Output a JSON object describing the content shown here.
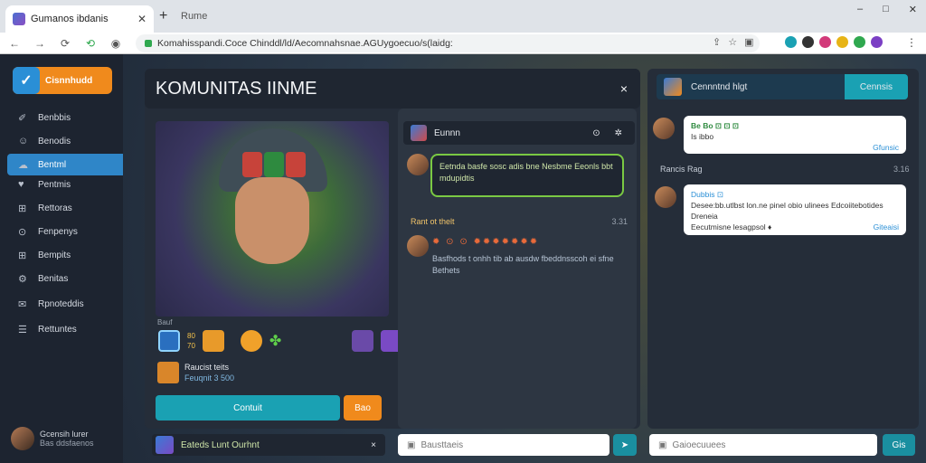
{
  "browser": {
    "tab_title": "Gumanos ibdanis",
    "tab2": "Rume",
    "url": "Komahisspandi.Coce Chinddl/ld/Aecomnahsnae.AGUygoecuo/s(laidg:"
  },
  "sidebar": {
    "logo": "Cisnnhudd",
    "items": [
      {
        "icon": "✐",
        "label": "Benbbis"
      },
      {
        "icon": "☺",
        "label": "Benodis"
      },
      {
        "icon": "☁",
        "label": "Bentml"
      },
      {
        "icon": "♥",
        "label": "Pentmis"
      },
      {
        "icon": "⊞",
        "label": "Rettoras"
      },
      {
        "icon": "⊙",
        "label": "Fenpenys"
      },
      {
        "icon": "⊞",
        "label": "Bempits"
      },
      {
        "icon": "⚙",
        "label": "Benitas"
      },
      {
        "icon": "✉",
        "label": "Rpnoteddis"
      },
      {
        "icon": "☰",
        "label": "Rettuntes"
      }
    ],
    "user_name": "Gcensih lurer",
    "user_sub": "Bas ddsfaenos"
  },
  "main": {
    "title": "KOMUNITAS IINME",
    "close": "×",
    "card_caption": "Bauf",
    "stats_top": "80",
    "stats_bottom": "70",
    "skill_label": "Raucist teits",
    "skill_sub": "Feuqnit 3 500",
    "primary_btn": "Contuit",
    "secondary_btn": "Bao"
  },
  "chat": {
    "header": "Eunnn",
    "icons": [
      "⊙",
      "✲"
    ],
    "message": "Eetnda basfe sosc adis bne Nesbme Eeonls bbt mdupidtis",
    "section": "Rant ot thelt",
    "section_count": "3.31",
    "emojis": "✹ ⊙ ⊙ ✹✹✹✹✹✹✹",
    "msg2": "Basfhods t onhh tib ab ausdw fbeddnsscoh ei sfne Bethets",
    "input_placeholder": "Bausttaeis",
    "bottom_label": "Eateds Lunt Ourhnt"
  },
  "right": {
    "header": "Cennntnd hlgt",
    "header_btn": "Cennsis",
    "card1_icons": "Be Bo ⊡ ⊡ ⊡",
    "card1_text": "Is ibbo",
    "card1_tag": "Gfunsic",
    "label": "Rancis Rag",
    "label_count": "3.16",
    "card2_title": "Dubbis ⊡",
    "card2_text": "Desee:bb.utlbst lon.ne pinel obio ulinees Edcoiitebotides Dreneia",
    "card2_sub": "Eecutmisne lesagpsol ♦",
    "card2_tag": "Giteaisi",
    "input_placeholder": "Gaioecuuees",
    "send": "Gis"
  }
}
